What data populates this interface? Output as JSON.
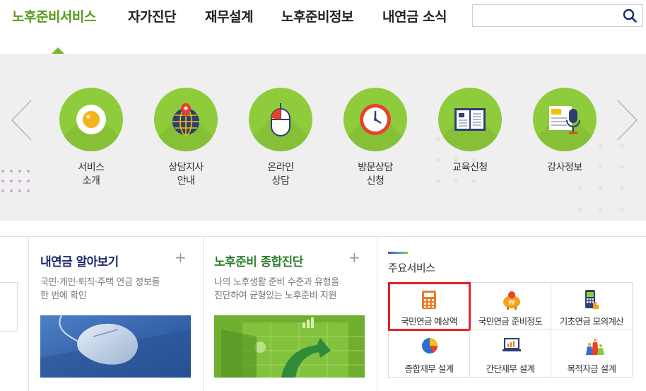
{
  "nav": {
    "items": [
      "노후준비서비스",
      "자가진단",
      "재무설계",
      "노후준비정보",
      "내연금 소식"
    ],
    "active_index": 0,
    "search_placeholder": ""
  },
  "services": [
    {
      "label": "서비스\n소개",
      "icon": "fried-egg-icon"
    },
    {
      "label": "상담지사\n안내",
      "icon": "globe-pin-icon"
    },
    {
      "label": "온라인\n상담",
      "icon": "mouse-icon"
    },
    {
      "label": "방문상담\n신청",
      "icon": "clock-icon"
    },
    {
      "label": "교육신청",
      "icon": "book-icon"
    },
    {
      "label": "강사정보",
      "icon": "microphone-icon"
    }
  ],
  "cards": [
    {
      "title": "내연금 알아보기",
      "desc": "국민·개인·퇴직·주택 연금 정보를\n한 번에 확인",
      "plus": "+"
    },
    {
      "title": "노후준비 종합진단",
      "desc": "나의 노후생활 준비 수준과 유형을\n진단하여 균형있는 노후준비 지원",
      "plus": "+"
    }
  ],
  "main_services": {
    "title": "주요서비스",
    "items": [
      {
        "label": "국민연금 예상액",
        "icon": "calculator-icon",
        "highlighted": true
      },
      {
        "label": "국민연금 준비정도",
        "icon": "piggy-bank-icon",
        "highlighted": false
      },
      {
        "label": "기초연금 모의계산",
        "icon": "phone-calculator-icon",
        "highlighted": false
      },
      {
        "label": "종합재무 설계",
        "icon": "pie-chart-icon",
        "highlighted": false
      },
      {
        "label": "간단재무 설계",
        "icon": "laptop-chart-icon",
        "highlighted": false
      },
      {
        "label": "목적자금 설계",
        "icon": "money-bags-icon",
        "highlighted": false
      }
    ]
  },
  "colors": {
    "accent": "#7ab52a",
    "circle": "#8fcc3c",
    "highlight": "#e3222b"
  }
}
